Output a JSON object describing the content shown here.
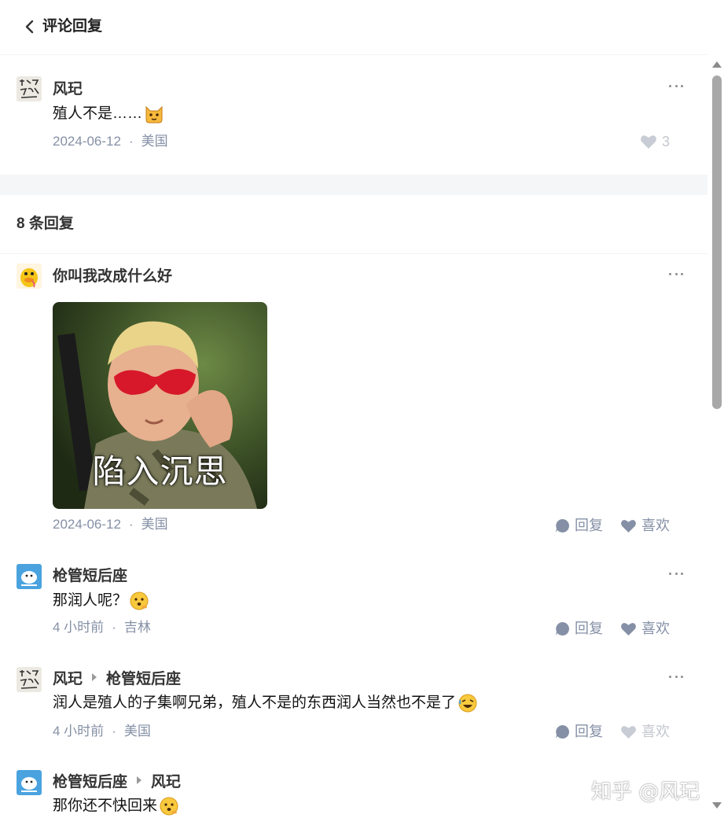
{
  "header": {
    "title": "评论回复"
  },
  "root_comment": {
    "author": "风玘",
    "text": "殖人不是……",
    "emoji": "cat-emoji",
    "date": "2024-06-12",
    "location": "美国",
    "likes": "3"
  },
  "replies_count": "8 条回复",
  "replies": [
    {
      "author": "你叫我改成什么好",
      "image_caption": "陷入沉思",
      "date": "2024-06-12",
      "location": "美国",
      "reply_label": "回复",
      "like_label": "喜欢"
    },
    {
      "author": "枪管短后座",
      "text": "那润人呢？",
      "emoji": "thinking-face-emoji",
      "date": "4 小时前",
      "location": "吉林",
      "reply_label": "回复",
      "like_label": "喜欢"
    },
    {
      "author": "风玘",
      "reply_to": "枪管短后座",
      "text": "润人是殖人的子集啊兄弟，殖人不是的东西润人当然也不是了",
      "emoji": "rofl-emoji",
      "date": "4 小时前",
      "location": "美国",
      "reply_label": "回复",
      "like_label": "喜欢"
    },
    {
      "author": "枪管短后座",
      "reply_to": "风玘",
      "text": "那你还不快回来",
      "emoji": "thinking-face-emoji"
    }
  ],
  "watermark": "知乎 @风玘",
  "colors": {
    "meta": "#8590a6",
    "divider": "#f5f6f7",
    "text": "#121212"
  }
}
